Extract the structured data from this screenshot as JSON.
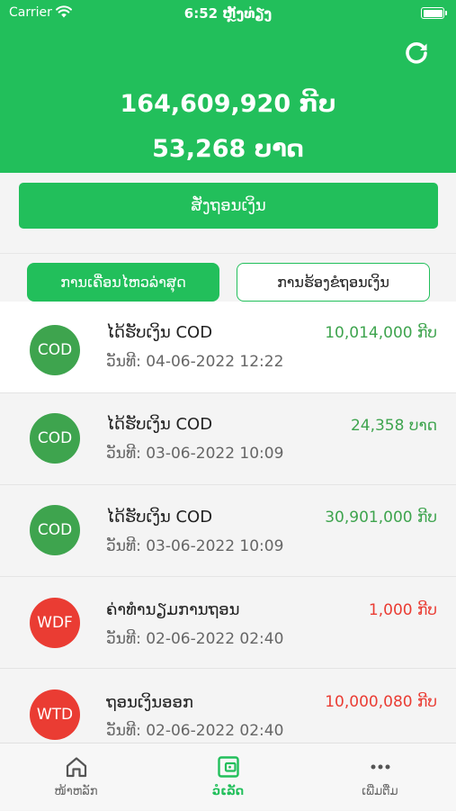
{
  "status_bar": {
    "carrier": "Carrier",
    "time": "6:52 ຫຼັງທ່ຽງ"
  },
  "header": {
    "balance_kip": "164,609,920 ກີບ",
    "balance_baht": "53,268 ບາດ",
    "color": "#22bf5b"
  },
  "withdraw_button": "ສັ່ງຖອນເງິນ",
  "tabs": [
    {
      "label": "ການເຄື່ອນໄຫວລ່າສຸດ",
      "active": true
    },
    {
      "label": "ການຮ້ອງຂໍຖອນເງິນ",
      "active": false
    }
  ],
  "transactions": [
    {
      "badge": "COD",
      "title": "ໄດ້ຮັບເງິນ COD",
      "date": "ວັນທີ: 04-06-2022 12:22",
      "amount": "10,014,000 ກີບ",
      "color": "#3ea44e"
    },
    {
      "badge": "COD",
      "title": "ໄດ້ຮັບເງິນ COD",
      "date": "ວັນທີ: 03-06-2022 10:09",
      "amount": "24,358 ບາດ",
      "color": "#3ea44e"
    },
    {
      "badge": "COD",
      "title": "ໄດ້ຮັບເງິນ COD",
      "date": "ວັນທີ: 03-06-2022 10:09",
      "amount": "30,901,000 ກີບ",
      "color": "#3ea44e"
    },
    {
      "badge": "WDF",
      "title": "ຄ່າທຳນຽມການຖອນ",
      "date": "ວັນທີ: 02-06-2022 02:40",
      "amount": "1,000 ກີບ",
      "color": "#ea3c33"
    },
    {
      "badge": "WTD",
      "title": "ຖອນເງິນອອກ",
      "date": "ວັນທີ: 02-06-2022 02:40",
      "amount": "10,000,080 ກີບ",
      "color": "#ea3c33"
    }
  ],
  "bottom_nav": [
    {
      "label": "ໜ້າຫລັກ",
      "icon": "home-icon",
      "active": false
    },
    {
      "label": "ວໍເລັດ",
      "icon": "wallet-icon",
      "active": true
    },
    {
      "label": "ເພີ່ມຕື່ມ",
      "icon": "more-icon",
      "active": false
    }
  ],
  "colors": {
    "accent": "#22bf5b",
    "positive": "#3ea44e",
    "negative": "#ea3c33",
    "nav_inactive": "#666666"
  }
}
